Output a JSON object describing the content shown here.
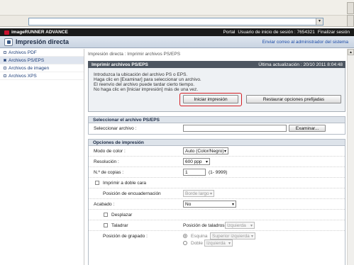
{
  "browser": {
    "address_dropdown_icon": "▾"
  },
  "app": {
    "brand": "imageRUNNER ADVANCE",
    "portal": "Portal",
    "login_user": "Usuario de inicio de sesión : 7654321",
    "logout": "Finalizar sesión"
  },
  "title_bar": {
    "title": "Impresión directa",
    "admin_link": "Enviar correo al administrador del sistema"
  },
  "sidebar": {
    "items": [
      {
        "label": "Archivos PDF",
        "active": false
      },
      {
        "label": "Archivos PS/EPS",
        "active": true
      },
      {
        "label": "Archivos de imagen",
        "active": false
      },
      {
        "label": "Archivos XPS",
        "active": false
      }
    ]
  },
  "main": {
    "breadcrumb": "Impresión directa : Imprimir archivos PS/EPS",
    "panel": {
      "title": "Imprimir archivos PS/EPS",
      "last_update": "Última actualización : 20/10 2011 8:04:48",
      "instructions": [
        "Introduzca la ubicación del archivo PS o EPS.",
        "Haga clic en [Examinar] para seleccionar un archivo.",
        "El reenvío del archivo puede tardar cierto tiempo.",
        "No haga clic en [Iniciar impresión] más de una vez."
      ],
      "start_button": "Iniciar impresión",
      "restore_button": "Restaurar opciones prefijadas"
    },
    "select_file": {
      "heading": "Seleccionar el archivo PS/EPS",
      "label": "Seleccionar archivo :",
      "value": "",
      "browse_button": "Examinar..."
    },
    "options": {
      "heading": "Opciones de impresión",
      "color_mode_label": "Modo de color :",
      "color_mode_value": "Auto (Color/Negro)",
      "resolution_label": "Resolución :",
      "resolution_value": "600 ppp",
      "copies_label": "N.º de copias :",
      "copies_value": "1",
      "copies_range": "(1- 9999)",
      "duplex_label": "Imprimir a doble cara",
      "duplex_checked": false,
      "binding_label": "Posición de encuadernación",
      "binding_value": "Borde largo",
      "finishing_label": "Acabado :",
      "finishing_value": "No",
      "offset_label": "Desplazar",
      "offset_checked": false,
      "punch_label": "Taladrar",
      "punch_checked": false,
      "punch_position_label": "Posición de taladros",
      "punch_position_value": "Izquierda",
      "staple_label": "Posición de grapado :",
      "corner_label": "Esquina",
      "corner_selected": true,
      "corner_value": "Superior izquierda",
      "double_label": "Doble",
      "double_value": "Izquierda"
    }
  },
  "icons": {
    "select_arrow": "▾",
    "scroll_up": "▲"
  }
}
